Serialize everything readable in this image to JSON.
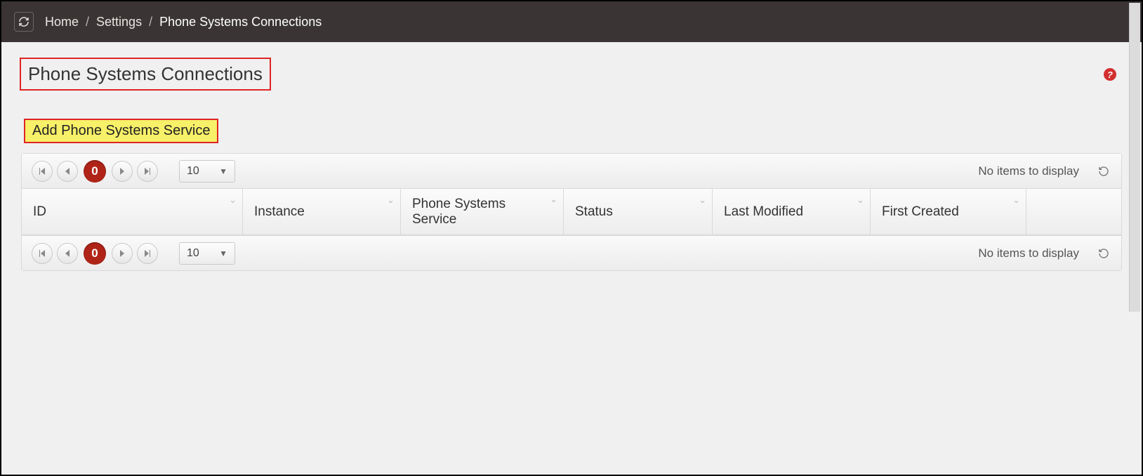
{
  "breadcrumb": {
    "home": "Home",
    "settings": "Settings",
    "current": "Phone Systems Connections",
    "separator": "/"
  },
  "page": {
    "title": "Phone Systems Connections",
    "add_button": "Add Phone Systems Service",
    "help_glyph": "?"
  },
  "grid": {
    "page_number": "0",
    "page_size": "10",
    "empty_message": "No items to display",
    "columns": {
      "id": "ID",
      "instance": "Instance",
      "service": "Phone Systems Service",
      "status": "Status",
      "modified": "Last Modified",
      "created": "First Created"
    }
  }
}
